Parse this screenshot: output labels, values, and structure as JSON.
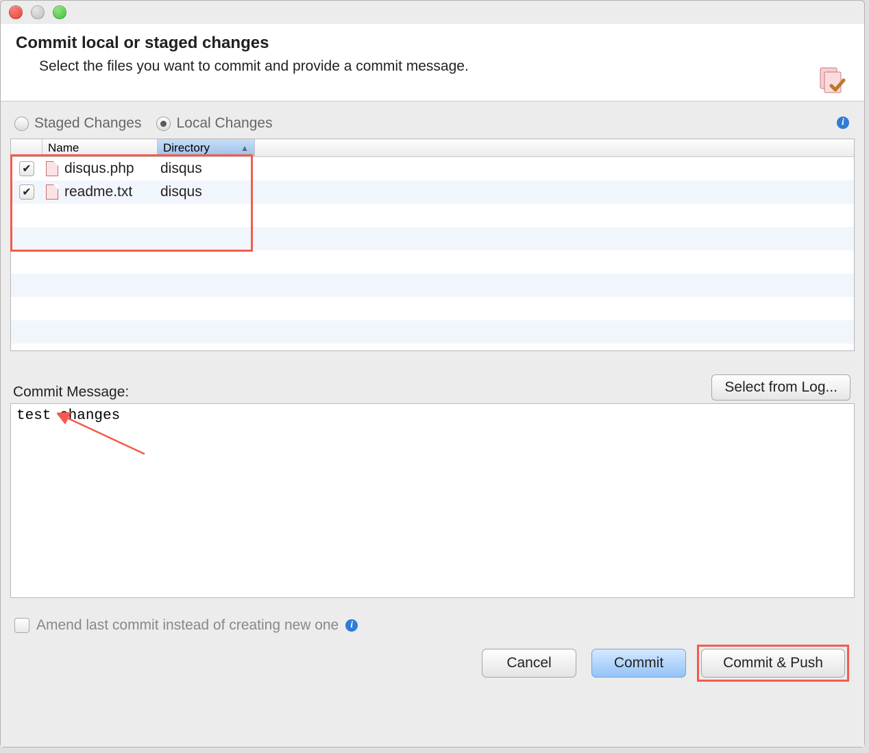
{
  "header": {
    "title": "Commit local or staged changes",
    "subtitle": "Select the files you want to commit and provide a commit message."
  },
  "changesTabs": {
    "staged": "Staged Changes",
    "local": "Local Changes",
    "selected": "local"
  },
  "columns": {
    "name": "Name",
    "directory": "Directory"
  },
  "files": [
    {
      "checked": true,
      "name": "disqus.php",
      "dir": "disqus"
    },
    {
      "checked": true,
      "name": "readme.txt",
      "dir": "disqus"
    }
  ],
  "commit": {
    "label": "Commit Message:",
    "selectFromLog": "Select from Log...",
    "message": "test changes"
  },
  "amend": {
    "label": "Amend last commit instead of creating new one",
    "checked": false
  },
  "buttons": {
    "cancel": "Cancel",
    "commit": "Commit",
    "commitPush": "Commit & Push"
  }
}
